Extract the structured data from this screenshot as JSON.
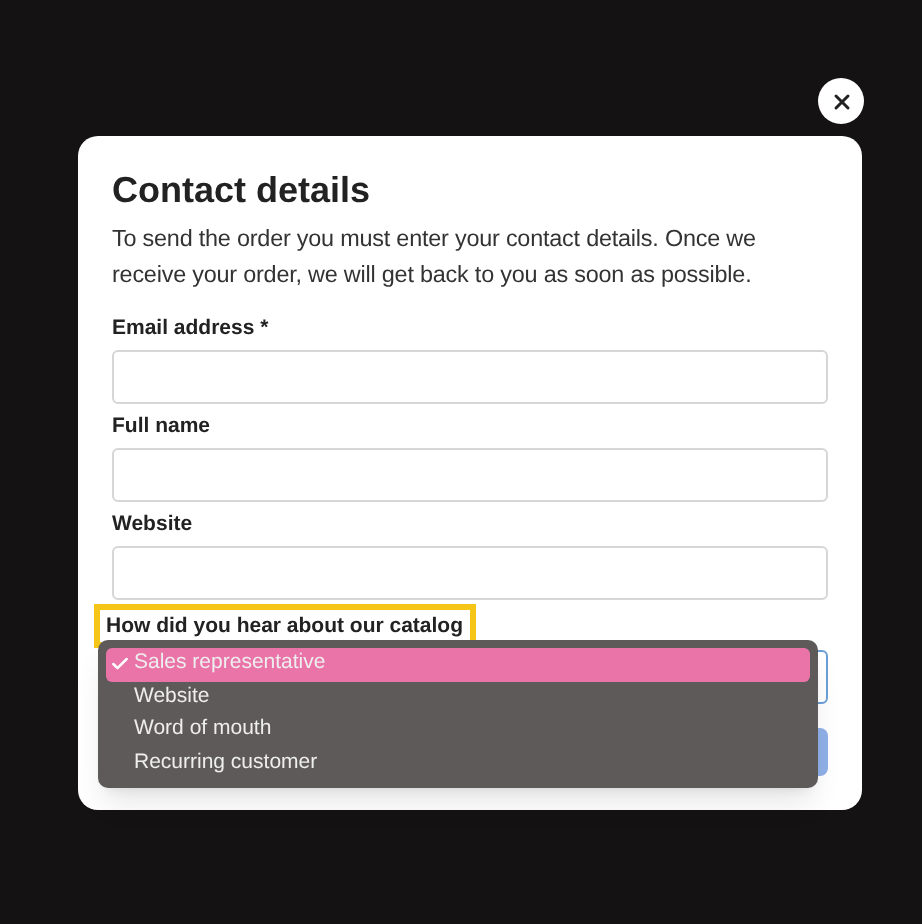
{
  "dialog": {
    "title": "Contact details",
    "description": "To send the order you must enter your contact details. Once we receive your order, we will get back to you as soon as possible.",
    "fields": [
      {
        "label": "Email address *",
        "highlighted": false,
        "focused": false
      },
      {
        "label": "Full name",
        "highlighted": false,
        "focused": false
      },
      {
        "label": "Website",
        "highlighted": false,
        "focused": false
      },
      {
        "label": "How did you hear about our catalog",
        "highlighted": true,
        "focused": true
      }
    ],
    "dropdown": {
      "options": [
        {
          "label": "Sales representative",
          "selected": true
        },
        {
          "label": "Website",
          "selected": false
        },
        {
          "label": "Word of mouth",
          "selected": false
        },
        {
          "label": "Recurring customer",
          "selected": false
        }
      ]
    }
  }
}
